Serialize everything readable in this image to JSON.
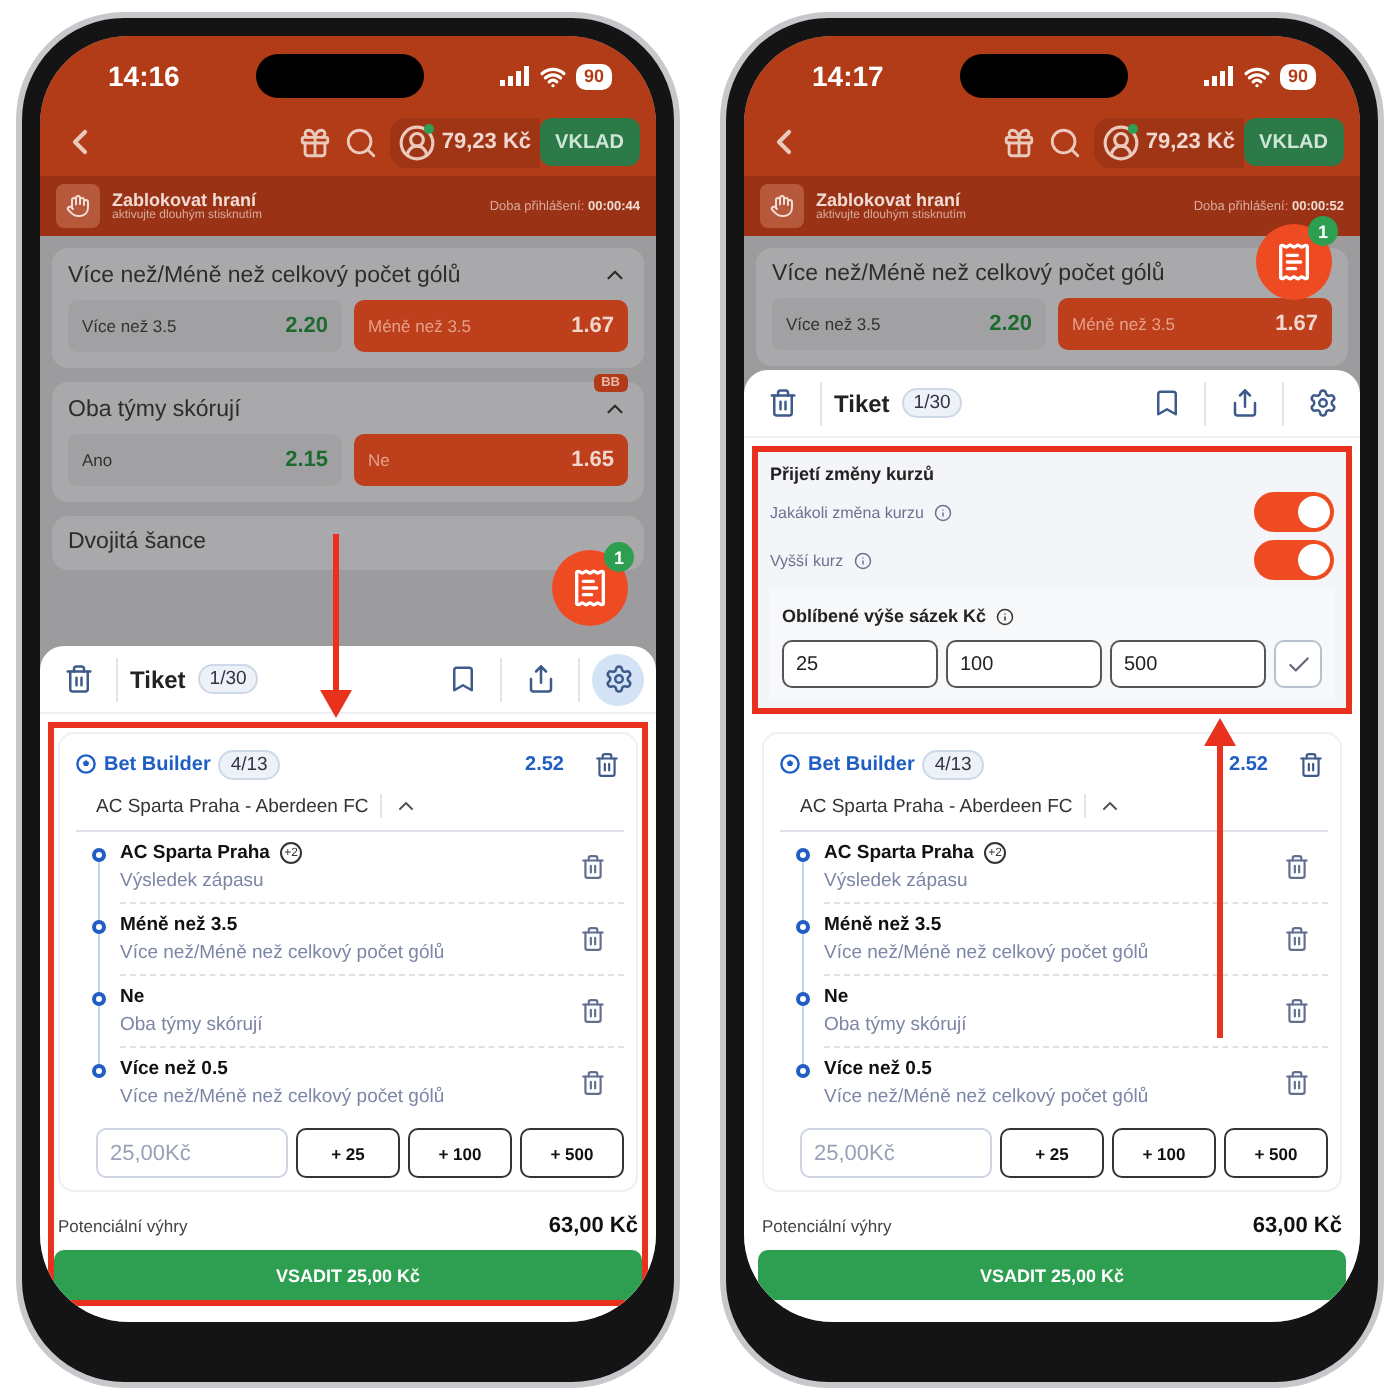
{
  "phones": [
    {
      "status_bar": {
        "time": "14:16",
        "battery": "90"
      },
      "header": {
        "balance": "79,23 Kč",
        "deposit": "VKLAD"
      },
      "banner": {
        "title": "Zablokovat hraní",
        "subtitle": "aktivujte dlouhým stisknutím",
        "login_label": "Doba přihlášení:",
        "login_time": "00:00:44"
      },
      "markets": [
        {
          "title": "Více než/Méně než celkový počet gólů",
          "expanded": true,
          "options": [
            {
              "label": "Více než 3.5",
              "odds": "2.20",
              "selected": false
            },
            {
              "label": "Méně než 3.5",
              "odds": "1.67",
              "selected": true
            }
          ]
        },
        {
          "title": "Oba týmy skórují",
          "tag": "BB",
          "expanded": true,
          "options": [
            {
              "label": "Ano",
              "odds": "2.15",
              "selected": false
            },
            {
              "label": "Ne",
              "odds": "1.65",
              "selected": true
            }
          ]
        },
        {
          "title": "Dvojitá šance"
        }
      ],
      "fab": {
        "badge": "1"
      },
      "ticket": {
        "title": "Tiket",
        "count": "1/30",
        "settings_selected": true
      },
      "bet_builder": {
        "title": "Bet Builder",
        "count": "4/13",
        "odds": "2.52",
        "match": "AC Sparta Praha - Aberdeen FC",
        "expanded": true,
        "legs": [
          {
            "name": "AC Sparta Praha",
            "badge": "+2",
            "market": "Výsledek zápasu"
          },
          {
            "name": "Méně než 3.5",
            "market": "Více než/Méně než celkový počet gólů"
          },
          {
            "name": "Ne",
            "market": "Oba týmy skórují"
          },
          {
            "name": "Více než 0.5",
            "market": "Více než/Méně než celkový počet gólů"
          }
        ]
      },
      "stake": {
        "value": "25,00Kč"
      },
      "quick_amounts": [
        "+ 25",
        "+ 100",
        "+ 500"
      ],
      "potential": {
        "label": "Potenciální výhry",
        "value": "63,00 Kč"
      },
      "place_bet": "VSADIT 25,00 Kč",
      "highlight": {
        "kind": "bet_slip"
      },
      "arrow": {
        "kind": "down"
      }
    },
    {
      "status_bar": {
        "time": "14:17",
        "battery": "90"
      },
      "header": {
        "balance": "79,23 Kč",
        "deposit": "VKLAD"
      },
      "banner": {
        "title": "Zablokovat hraní",
        "subtitle": "aktivujte dlouhým stisknutím",
        "login_label": "Doba přihlášení:",
        "login_time": "00:00:52"
      },
      "markets": [
        {
          "title": "Více než/Méně než celkový počet gólů",
          "options": [
            {
              "label": "Více než 3.5",
              "odds": "2.20",
              "selected": false
            },
            {
              "label": "Méně než 3.5",
              "odds": "1.67",
              "selected": true
            }
          ]
        }
      ],
      "fab": {
        "badge": "1"
      },
      "ticket": {
        "title": "Tiket",
        "count": "1/30",
        "settings_selected": false
      },
      "settings": {
        "title": "Přijetí změny kurzů",
        "options": [
          {
            "label": "Jakákoli změna kurzu",
            "on": true
          },
          {
            "label": "Vyšší kurz",
            "on": true
          }
        ],
        "favorites_title": "Oblíbené výše sázek Kč",
        "favorites": [
          "25",
          "100",
          "500"
        ]
      },
      "bet_builder": {
        "title": "Bet Builder",
        "count": "4/13",
        "odds": "2.52",
        "match": "AC Sparta Praha - Aberdeen FC",
        "expanded": true,
        "legs": [
          {
            "name": "AC Sparta Praha",
            "badge": "+2",
            "market": "Výsledek zápasu"
          },
          {
            "name": "Méně než 3.5",
            "market": "Více než/Méně než celkový počet gólů"
          },
          {
            "name": "Ne",
            "market": "Oba týmy skórují"
          },
          {
            "name": "Více než 0.5",
            "market": "Více než/Méně než celkový počet gólů"
          }
        ]
      },
      "stake": {
        "value": "25,00Kč"
      },
      "quick_amounts": [
        "+ 25",
        "+ 100",
        "+ 500"
      ],
      "potential": {
        "label": "Potenciální výhry",
        "value": "63,00 Kč"
      },
      "place_bet": "VSADIT 25,00 Kč",
      "highlight": {
        "kind": "settings"
      },
      "arrow": {
        "kind": "up"
      }
    }
  ]
}
